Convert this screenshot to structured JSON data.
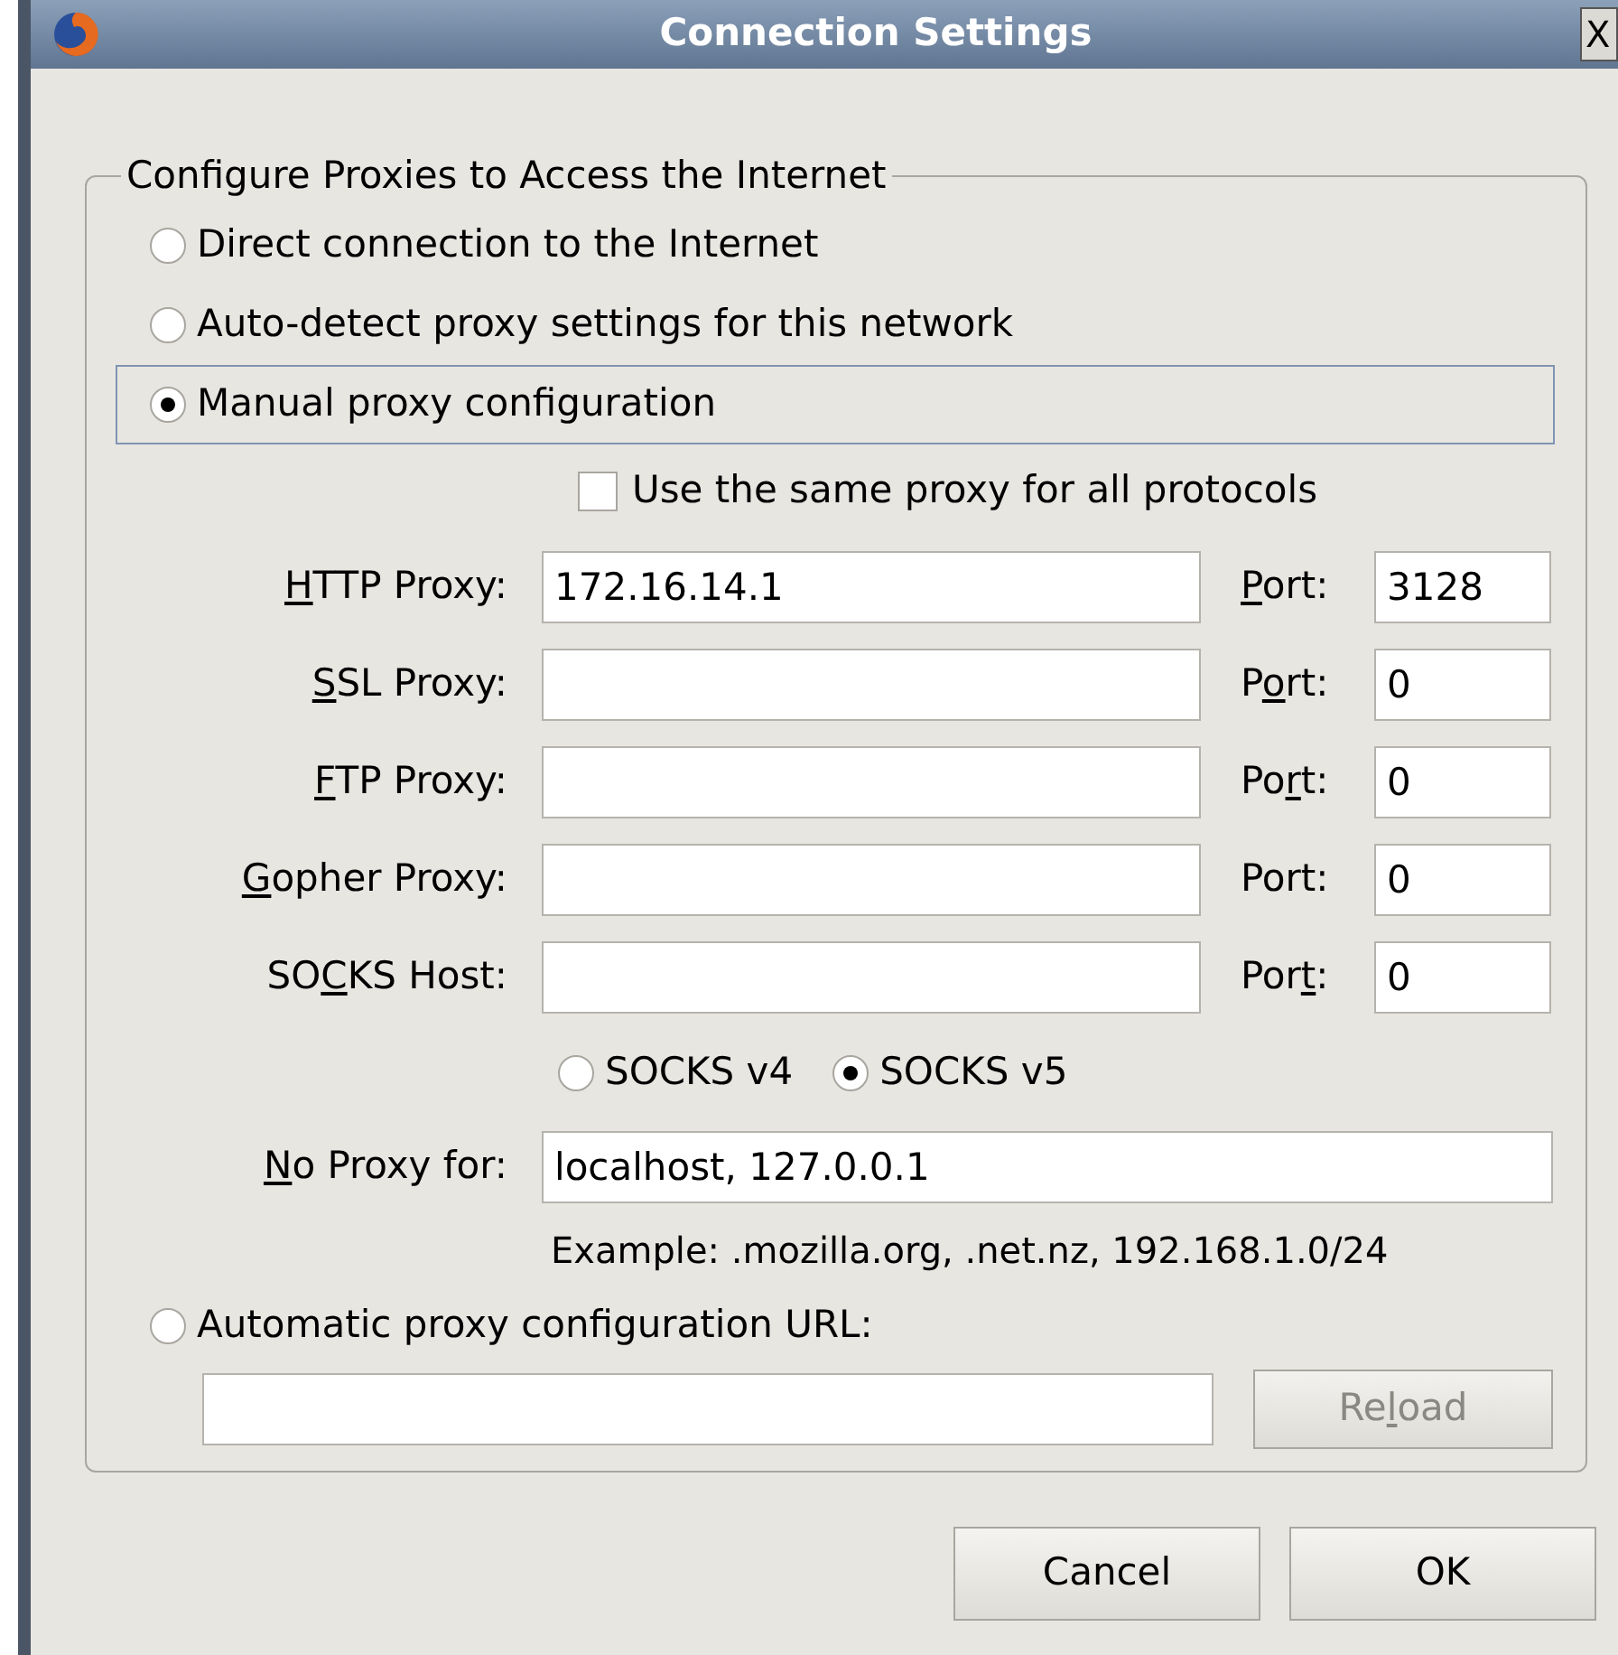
{
  "window": {
    "title": "Connection Settings",
    "close": "X"
  },
  "group": {
    "title": "Configure Proxies to Access the Internet",
    "modes": [
      {
        "label": "Direct connection to the Internet",
        "selected": false
      },
      {
        "label": "Auto-detect proxy settings for this network",
        "selected": false
      },
      {
        "label": "Manual proxy configuration",
        "selected": true
      }
    ],
    "same_proxy": {
      "label": "Use the same proxy for all protocols",
      "checked": false
    },
    "proxies": [
      {
        "label": {
          "key": "H",
          "post": "TTP Proxy:"
        },
        "value": "172.16.14.1",
        "port_label": {
          "key": "P",
          "post": "ort:"
        },
        "port": "3128"
      },
      {
        "label": {
          "key": "S",
          "post": "SL Proxy:"
        },
        "port_label": {
          "pre": "P",
          "key": "o",
          "post": "rt:"
        },
        "port": "0"
      },
      {
        "label": {
          "key": "F",
          "post": "TP Proxy:"
        },
        "port_label": {
          "pre": "Po",
          "key": "r",
          "post": "t:"
        },
        "port": "0"
      },
      {
        "label": {
          "key": "G",
          "post": "opher Proxy:"
        },
        "port_label": {
          "pre": "Port:"
        },
        "port": "0"
      },
      {
        "label": {
          "pre": "SO",
          "key": "C",
          "post": "KS Host:"
        },
        "port_label": {
          "pre": "Por",
          "key": "t",
          "post": ":"
        },
        "port": "0"
      }
    ],
    "socks_versions": [
      {
        "label": "SOCKS v4",
        "selected": false
      },
      {
        "label": "SOCKS v5",
        "selected": true
      }
    ],
    "no_proxy": {
      "label": {
        "key": "N",
        "post": "o Proxy for:"
      },
      "value": "localhost, 127.0.0.1"
    },
    "example": "Example: .mozilla.org, .net.nz, 192.168.1.0/24",
    "auto_url": {
      "label": "Automatic proxy configuration URL:",
      "selected": false,
      "reload": {
        "pre": "Re",
        "key": "l",
        "post": "oad"
      },
      "reload_disabled": true
    }
  },
  "buttons": [
    "Cancel",
    "OK"
  ]
}
